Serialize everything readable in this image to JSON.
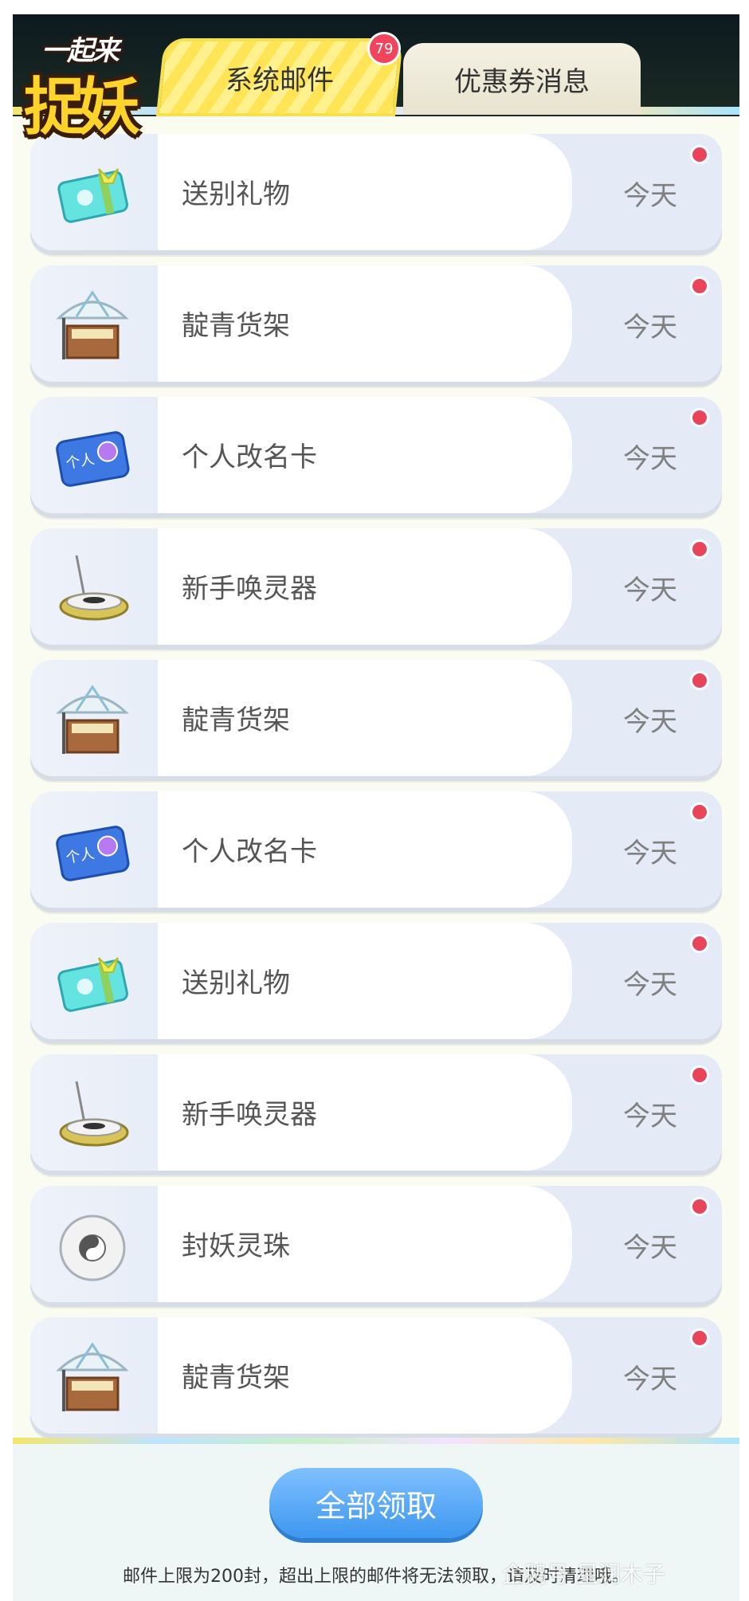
{
  "logo": {
    "top_text": "一起来",
    "main_text": "捉妖"
  },
  "tabs": [
    {
      "label": "系统邮件",
      "badge": "79",
      "active": true
    },
    {
      "label": "优惠券消息",
      "active": false
    }
  ],
  "mails": [
    {
      "title": "送别礼物",
      "date": "今天",
      "icon": "gift-ticket-icon"
    },
    {
      "title": "靛青货架",
      "date": "今天",
      "icon": "market-stall-icon"
    },
    {
      "title": "个人改名卡",
      "date": "今天",
      "icon": "rename-card-icon"
    },
    {
      "title": "新手唤灵器",
      "date": "今天",
      "icon": "summon-device-icon"
    },
    {
      "title": "靛青货架",
      "date": "今天",
      "icon": "market-stall-icon"
    },
    {
      "title": "个人改名卡",
      "date": "今天",
      "icon": "rename-card-icon"
    },
    {
      "title": "送别礼物",
      "date": "今天",
      "icon": "gift-ticket-icon"
    },
    {
      "title": "新手唤灵器",
      "date": "今天",
      "icon": "summon-device-icon"
    },
    {
      "title": "封妖灵珠",
      "date": "今天",
      "icon": "spirit-orb-icon"
    },
    {
      "title": "靛青货架",
      "date": "今天",
      "icon": "market-stall-icon"
    }
  ],
  "footer": {
    "claim_all_label": "全部领取",
    "note": "邮件上限为200封，超出上限的邮件将无法领取，请及时清理哦。"
  },
  "watermark": "企鹅号 星润木子",
  "colors": {
    "accent_blue": "#3d97ef",
    "unread_dot": "#e8455a",
    "tab_yellow": "#ffe455"
  }
}
